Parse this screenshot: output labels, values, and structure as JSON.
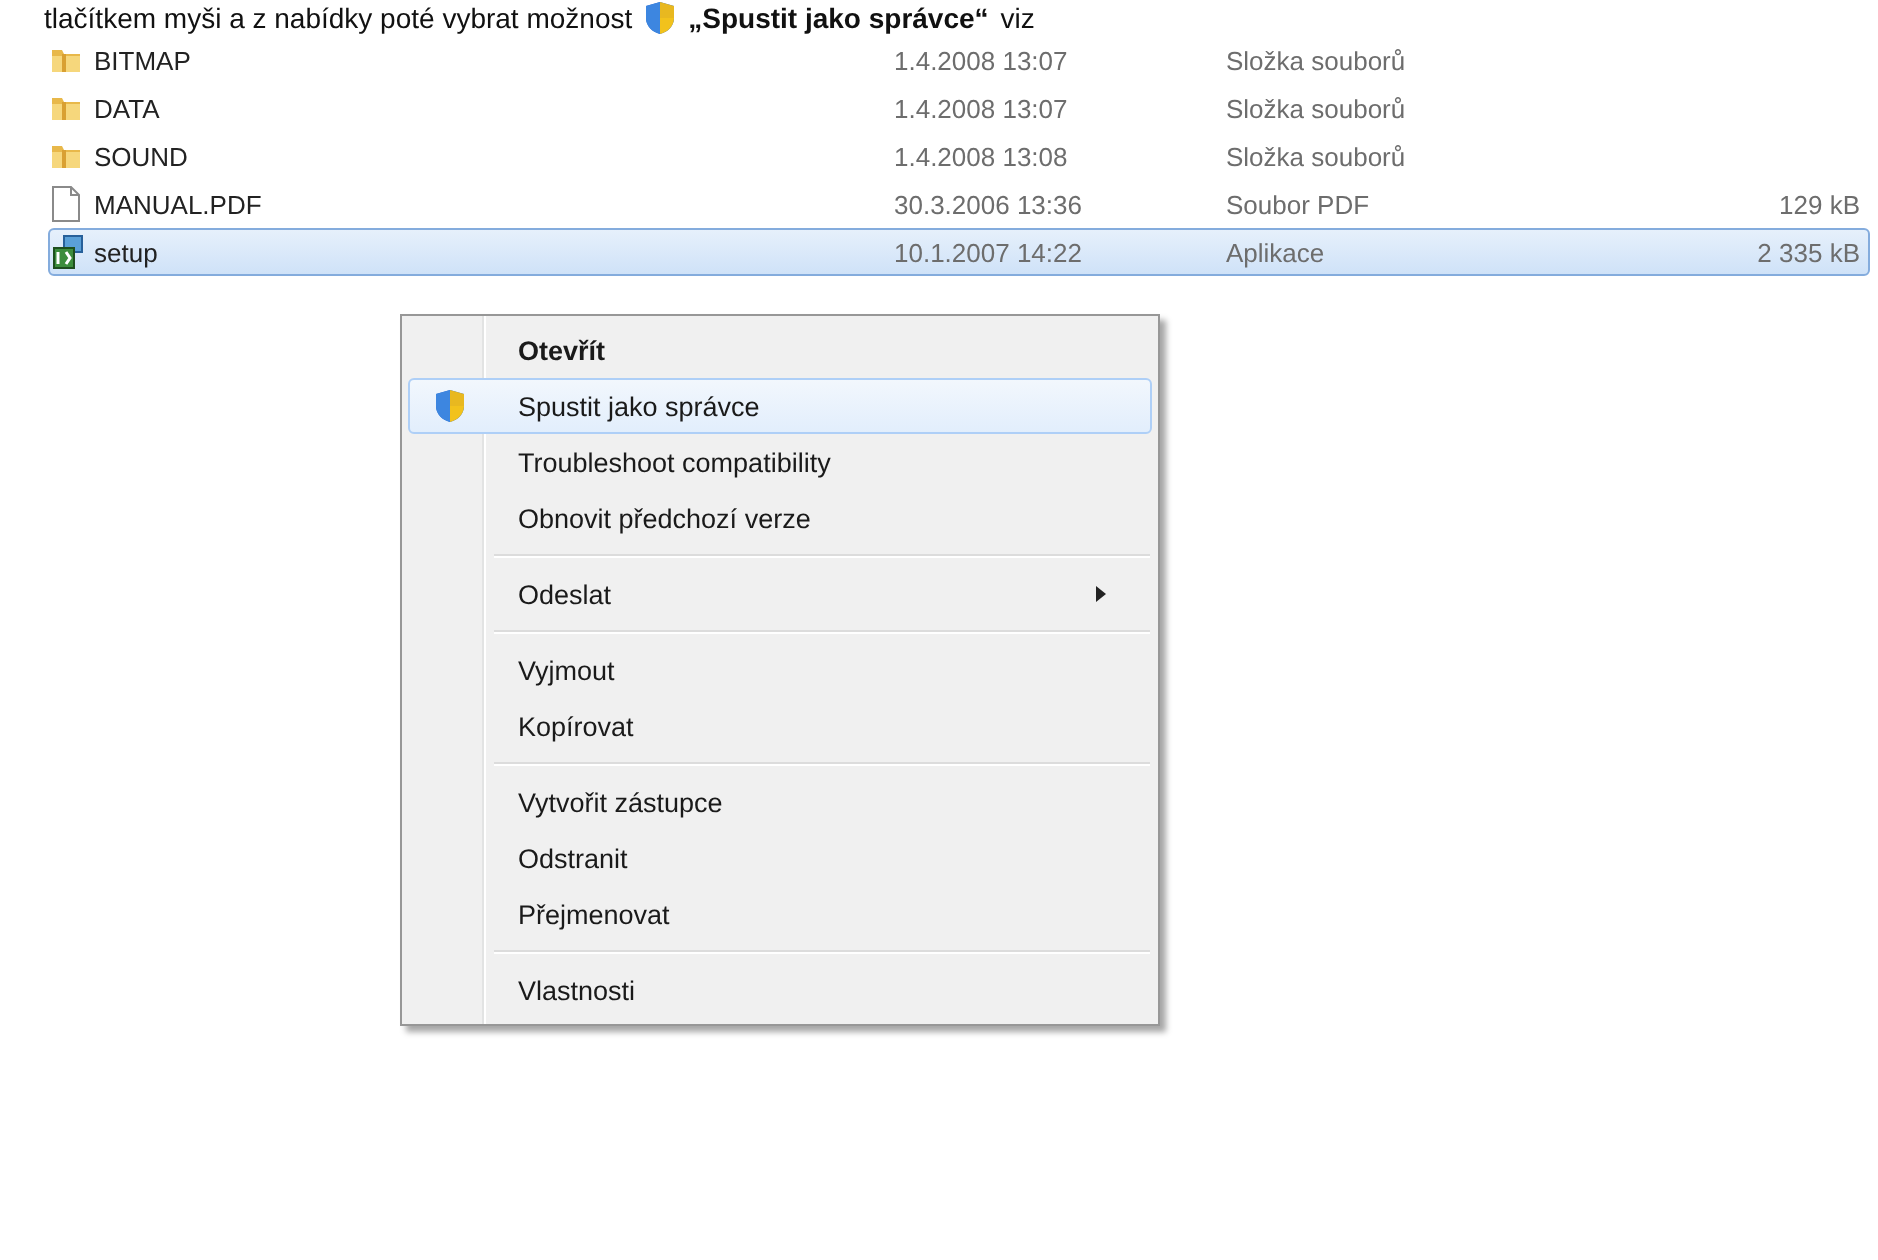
{
  "caption": {
    "before": "tlačítkem myši a z nabídky poté vybrat možnost",
    "emphasis": "„Spustit jako správce“",
    "after": "viz"
  },
  "files": [
    {
      "kind": "folder",
      "name": "BITMAP",
      "date": "1.4.2008 13:07",
      "type": "Složka souborů",
      "selected": false
    },
    {
      "kind": "folder",
      "name": "DATA",
      "date": "1.4.2008 13:07",
      "type": "Složka souborů",
      "selected": false
    },
    {
      "kind": "folder",
      "name": "SOUND",
      "date": "1.4.2008 13:08",
      "type": "Složka souborů",
      "selected": false
    },
    {
      "kind": "document",
      "name": "MANUAL.PDF",
      "date": "30.3.2006 13:36",
      "type": "Soubor PDF",
      "size": "129 kB",
      "selected": false
    },
    {
      "kind": "installer",
      "name": "setup",
      "date": "10.1.2007 14:22",
      "type": "Aplikace",
      "size": "2 335 kB",
      "selected": true
    }
  ],
  "context_menu": {
    "groups": [
      [
        {
          "kind": "default",
          "label": "Otevřít",
          "selected": false
        },
        {
          "kind": "elevated",
          "label": "Spustit jako správce",
          "selected": true
        },
        {
          "kind": "plain",
          "label": "Troubleshoot compatibility",
          "selected": false
        },
        {
          "kind": "plain",
          "label": "Obnovit předchozí verze",
          "selected": false
        }
      ],
      [
        {
          "kind": "submenu",
          "label": "Odeslat",
          "selected": false
        }
      ],
      [
        {
          "kind": "plain",
          "label": "Vyjmout",
          "selected": false
        },
        {
          "kind": "plain",
          "label": "Kopírovat",
          "selected": false
        }
      ],
      [
        {
          "kind": "plain",
          "label": "Vytvořit zástupce",
          "selected": false
        },
        {
          "kind": "plain",
          "label": "Odstranit",
          "selected": false
        },
        {
          "kind": "plain",
          "label": "Přejmenovat",
          "selected": false
        }
      ],
      [
        {
          "kind": "plain",
          "label": "Vlastnosti",
          "selected": false
        }
      ]
    ]
  }
}
